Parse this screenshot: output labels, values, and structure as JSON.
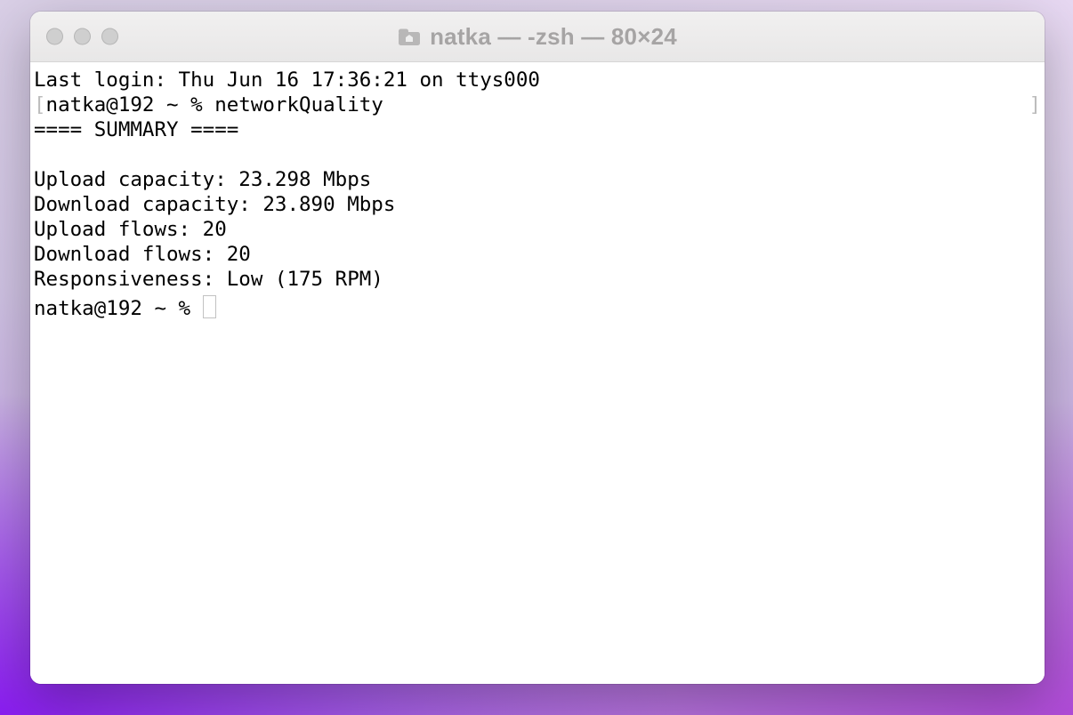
{
  "window": {
    "title": "natka — -zsh — 80×24"
  },
  "terminal": {
    "last_login": "Last login: Thu Jun 16 17:36:21 on ttys000",
    "prompt1": "natka@192 ~ % ",
    "command1": "networkQuality",
    "summary_header": "==== SUMMARY ====",
    "upload_capacity": "Upload capacity: 23.298 Mbps",
    "download_capacity": "Download capacity: 23.890 Mbps",
    "upload_flows": "Upload flows: 20",
    "download_flows": "Download flows: 20",
    "responsiveness": "Responsiveness: Low (175 RPM)",
    "prompt2": "natka@192 ~ % "
  }
}
